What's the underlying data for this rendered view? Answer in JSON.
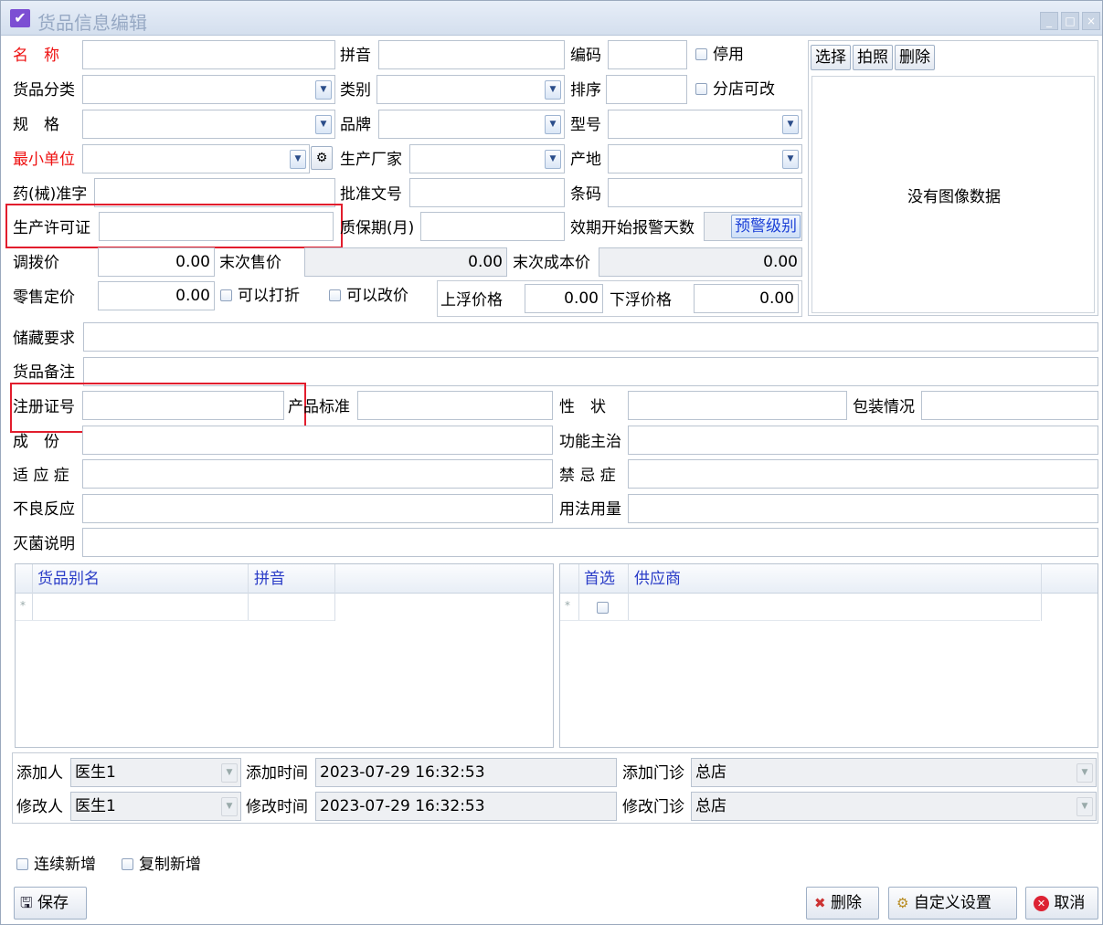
{
  "title": "货品信息编辑",
  "window_buttons": {
    "min": "_",
    "max": "□",
    "close": "×"
  },
  "labels": {
    "name": "名　称",
    "pinyin": "拼音",
    "code": "编码",
    "disabled": "停用",
    "category": "货品分类",
    "kind": "类别",
    "sort": "排序",
    "branch_editable": "分店可改",
    "spec": "规　格",
    "brand": "品牌",
    "model": "型号",
    "min_unit": "最小单位",
    "manufacturer": "生产厂家",
    "origin": "产地",
    "approval_char": "药(械)准字",
    "approval_no": "批准文号",
    "barcode": "条码",
    "license": "生产许可证",
    "shelf_life": "质保期(月)",
    "warn_days": "效期开始报警天数",
    "transfer_price": "调拨价",
    "last_sale": "末次售价",
    "last_cost": "末次成本价",
    "retail_price": "零售定价",
    "discount": "可以打折",
    "change_price": "可以改价",
    "upper_price": "上浮价格",
    "lower_price": "下浮价格",
    "storage": "储藏要求",
    "remark": "货品备注",
    "reg_no": "注册证号",
    "product_std": "产品标准",
    "character": "性　状",
    "package": "包装情况",
    "ingredients": "成　份",
    "function": "功能主治",
    "indication": "适 应 症",
    "contra": "禁 忌 症",
    "adverse": "不良反应",
    "usage": "用法用量",
    "sterilize": "灭菌说明",
    "added_by": "添加人",
    "added_time": "添加时间",
    "added_clinic": "添加门诊",
    "modified_by": "修改人",
    "modified_time": "修改时间",
    "modified_clinic": "修改门诊",
    "continuous_add": "连续新增",
    "copy_add": "复制新增"
  },
  "values": {
    "transfer_price": "0.00",
    "last_sale": "0.00",
    "last_cost": "0.00",
    "retail_price": "0.00",
    "upper_price": "0.00",
    "lower_price": "0.00",
    "added_by": "医生1",
    "added_time": "2023-07-29 16:32:53",
    "added_clinic": "总店",
    "modified_by": "医生1",
    "modified_time": "2023-07-29 16:32:53",
    "modified_clinic": "总店"
  },
  "image_panel": {
    "select": "选择",
    "photo": "拍照",
    "delete": "删除",
    "empty": "没有图像数据"
  },
  "warn_level_button": "预警级别",
  "alias_grid": {
    "columns": [
      "货品别名",
      "拼音"
    ],
    "new_row_marker": "*"
  },
  "supplier_grid": {
    "columns": [
      "首选",
      "供应商"
    ],
    "new_row_marker": "*"
  },
  "buttons": {
    "save": "保存",
    "delete": "删除",
    "custom": "自定义设置",
    "cancel": "取消"
  },
  "icons": {
    "save": "floppy-icon",
    "delete": "delete-doc-icon",
    "custom": "settings-doc-icon",
    "cancel": "cancel-icon"
  }
}
